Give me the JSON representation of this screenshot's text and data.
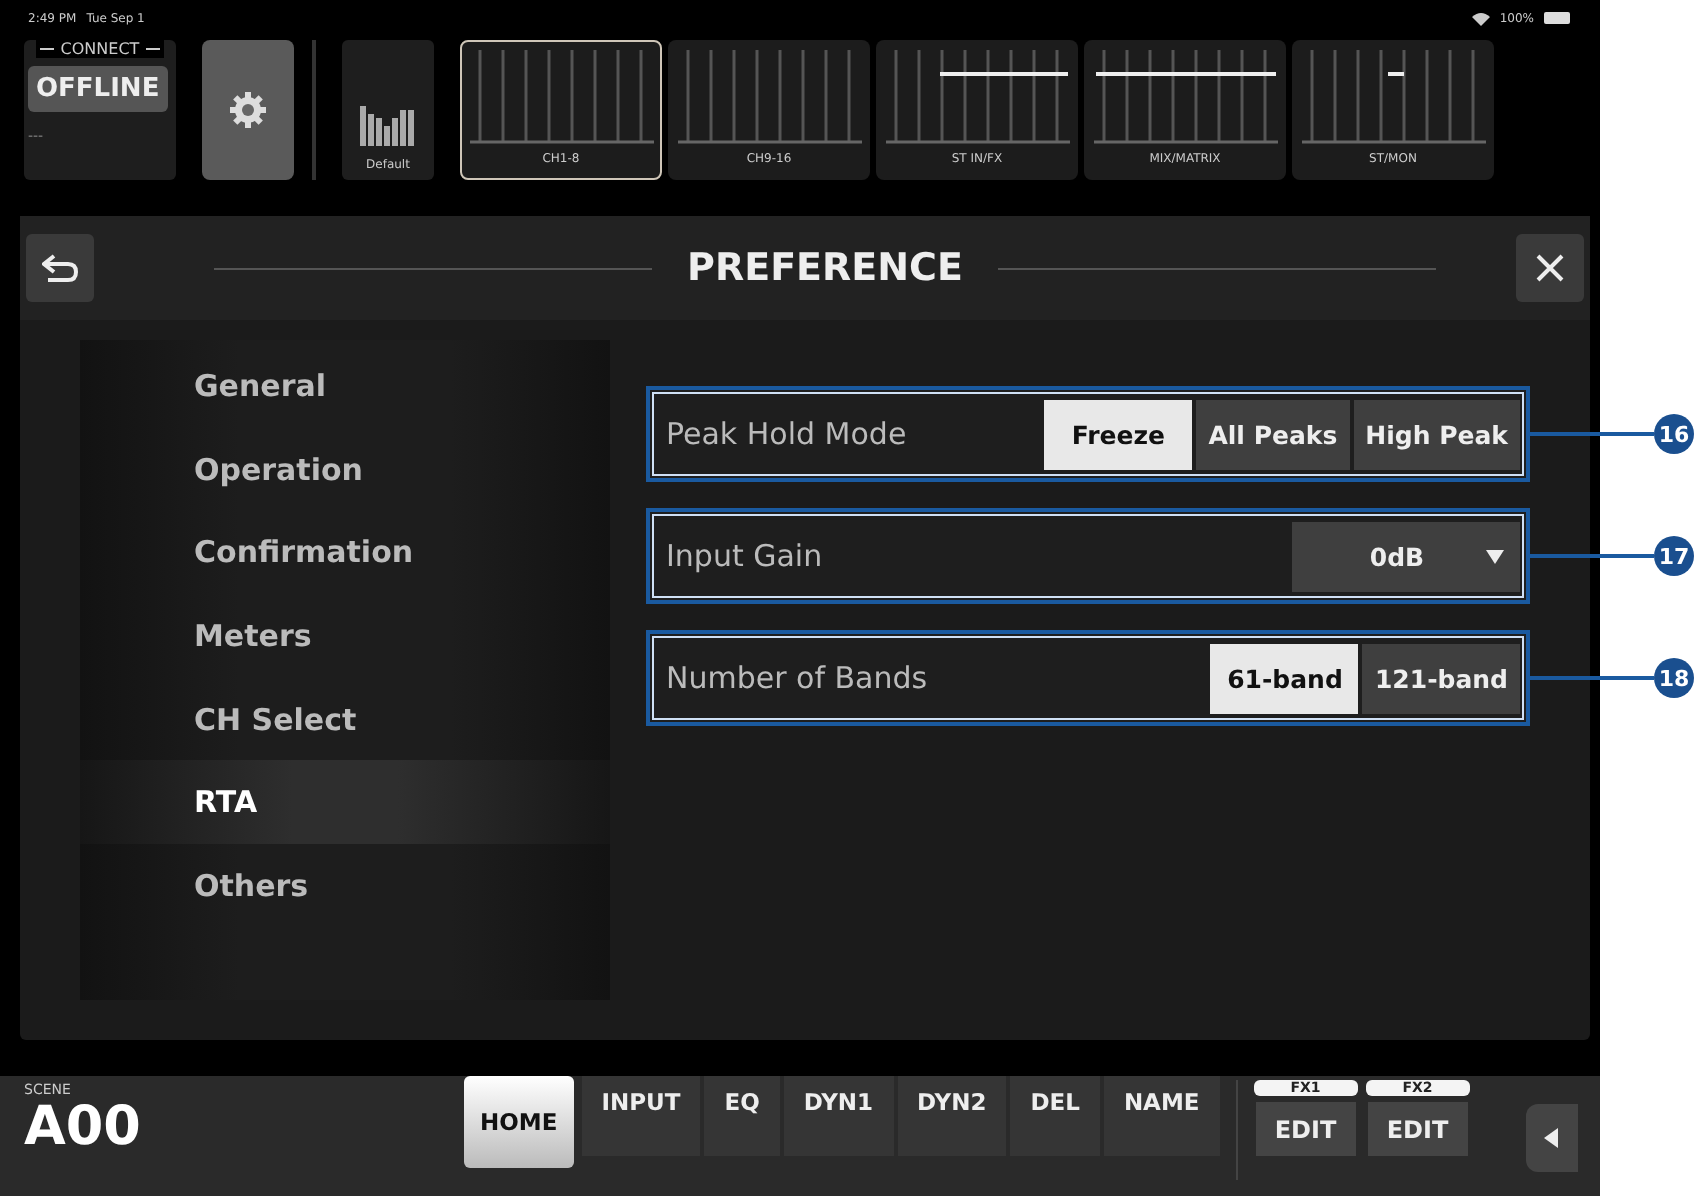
{
  "status_bar": {
    "time": "2:49 PM",
    "date": "Tue Sep 1",
    "battery": "100%"
  },
  "connect": {
    "label": "CONNECT",
    "button": "OFFLINE",
    "device": "---"
  },
  "library": {
    "label": "Default"
  },
  "banks": [
    {
      "label": "CH1-8",
      "selected": true
    },
    {
      "label": "CH9-16",
      "selected": false
    },
    {
      "label": "ST IN/FX",
      "selected": false
    },
    {
      "label": "MIX/MATRIX",
      "selected": false
    },
    {
      "label": "ST/MON",
      "selected": false
    }
  ],
  "dialog": {
    "title": "PREFERENCE"
  },
  "sidebar": {
    "items": [
      {
        "label": "General",
        "selected": false
      },
      {
        "label": "Operation",
        "selected": false
      },
      {
        "label": "Confirmation",
        "selected": false
      },
      {
        "label": "Meters",
        "selected": false
      },
      {
        "label": "CH Select",
        "selected": false
      },
      {
        "label": "RTA",
        "selected": true
      },
      {
        "label": "Others",
        "selected": false
      }
    ]
  },
  "settings": [
    {
      "kind": "segmented",
      "label": "Peak Hold Mode",
      "callout": "16",
      "options": [
        {
          "label": "Freeze",
          "selected": true
        },
        {
          "label": "All Peaks",
          "selected": false
        },
        {
          "label": "High Peak",
          "selected": false
        }
      ]
    },
    {
      "kind": "dropdown",
      "label": "Input Gain",
      "callout": "17",
      "value": "0dB"
    },
    {
      "kind": "segmented",
      "label": "Number of Bands",
      "callout": "18",
      "options": [
        {
          "label": "61-band",
          "selected": true
        },
        {
          "label": "121-band",
          "selected": false
        }
      ]
    }
  ],
  "scene": {
    "label": "SCENE",
    "value": "A00"
  },
  "tabs": [
    {
      "label": "HOME",
      "selected": true
    },
    {
      "label": "INPUT",
      "selected": false
    },
    {
      "label": "EQ",
      "selected": false
    },
    {
      "label": "DYN1",
      "selected": false
    },
    {
      "label": "DYN2",
      "selected": false
    },
    {
      "label": "DEL",
      "selected": false
    },
    {
      "label": "NAME",
      "selected": false
    }
  ],
  "fx": [
    {
      "label": "FX1",
      "button": "EDIT"
    },
    {
      "label": "FX2",
      "button": "EDIT"
    }
  ]
}
